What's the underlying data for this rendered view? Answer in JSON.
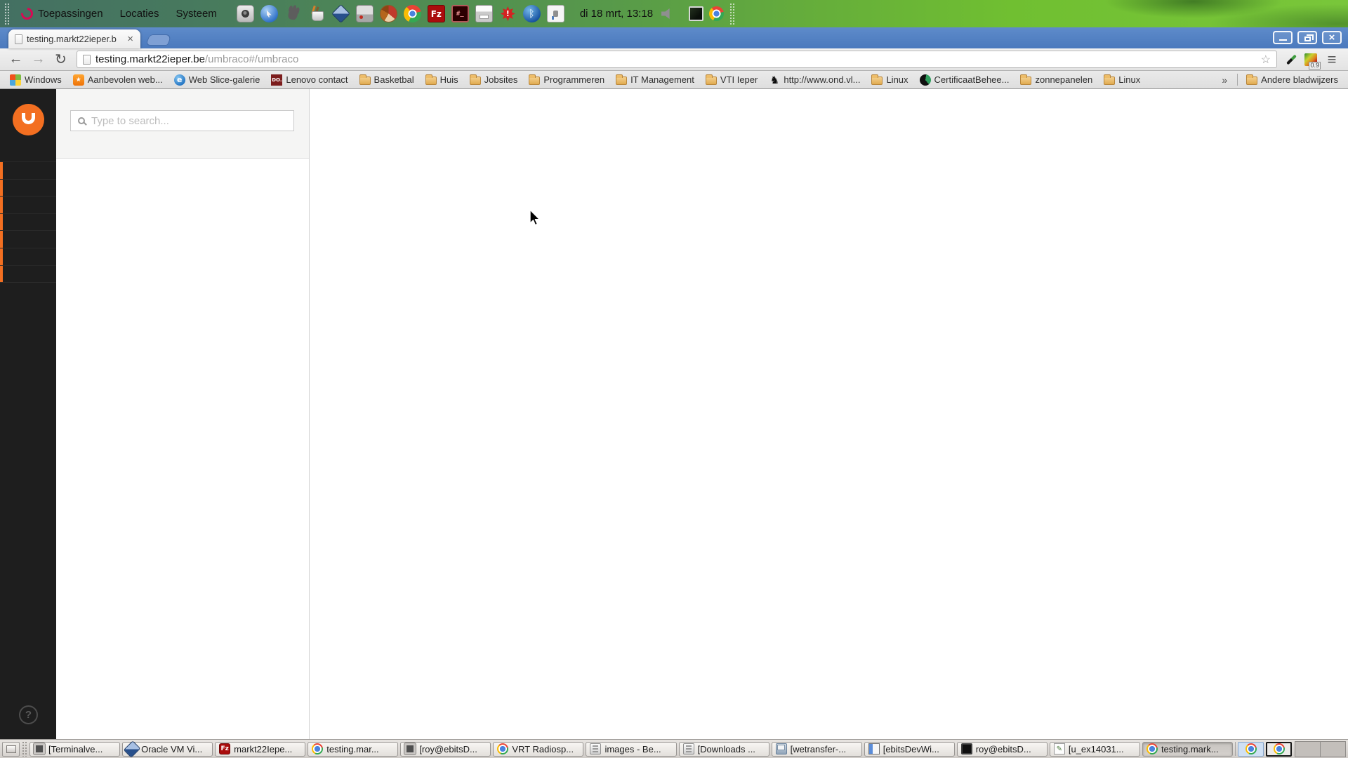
{
  "colors": {
    "umbraco_orange": "#f36f21",
    "chrome_frame_blue": "#4d7bbd",
    "panel_green": "#6ab92f",
    "sidebar_dark": "#1e1e1e"
  },
  "desktop": {
    "top_panel": {
      "menus": [
        {
          "label": "Toepassingen",
          "icon": "debian-swirl-icon"
        },
        {
          "label": "Locaties"
        },
        {
          "label": "Systeem"
        }
      ],
      "launchers": [
        {
          "icon": "speaker-icon"
        },
        {
          "icon": "web-browser-icon"
        },
        {
          "icon": "gnome-foot-icon"
        },
        {
          "icon": "graphics-tools-icon"
        },
        {
          "icon": "virtualbox-icon"
        },
        {
          "icon": "harddrive-icon"
        },
        {
          "icon": "disk-usage-icon"
        },
        {
          "icon": "chrome-icon"
        },
        {
          "icon": "filezilla-icon",
          "glyph": "Fz"
        },
        {
          "icon": "terminal-red-icon",
          "glyph": "#_"
        },
        {
          "icon": "printer-icon"
        },
        {
          "icon": "alert-icon"
        },
        {
          "icon": "bluetooth-icon"
        },
        {
          "icon": "network-icon"
        }
      ],
      "clock": "di 18 mrt, 13:18",
      "tray": [
        {
          "icon": "terminal-window-icon"
        },
        {
          "icon": "chrome-icon"
        }
      ]
    },
    "taskbar": {
      "items": [
        {
          "label": "[Terminalve...",
          "icon": "terminal-icon"
        },
        {
          "label": "Oracle VM Vi...",
          "icon": "virtualbox-icon"
        },
        {
          "label": "markt22Iepe...",
          "icon": "filezilla-icon",
          "glyph": "Fz"
        },
        {
          "label": "testing.mar...",
          "icon": "chrome-icon"
        },
        {
          "label": "[roy@ebitsD...",
          "icon": "terminal-icon"
        },
        {
          "label": "VRT Radiosp...",
          "icon": "chrome-icon"
        },
        {
          "label": "images - Be...",
          "icon": "file-manager-icon"
        },
        {
          "label": "[Downloads ...",
          "icon": "file-manager-icon"
        },
        {
          "label": "[wetransfer-...",
          "icon": "archive-icon"
        },
        {
          "label": "[ebitsDevWi...",
          "icon": "spreadsheet-icon"
        },
        {
          "label": "roy@ebitsD...",
          "icon": "terminal-dark-icon"
        },
        {
          "label": "[u_ex14031...",
          "icon": "text-editor-icon"
        },
        {
          "label": "testing.mark...",
          "icon": "chrome-icon",
          "cls": "active"
        }
      ],
      "tray": [
        {
          "icon": "chrome-icon",
          "cls": "selected"
        },
        {
          "icon": "chrome-icon",
          "cls": "outlined"
        }
      ],
      "workspace_count": 2
    }
  },
  "browser": {
    "tab": {
      "title": "testing.markt22ieper.b",
      "close_glyph": "×"
    },
    "toolbar": {
      "back_glyph": "←",
      "forward_glyph": "→",
      "reload_glyph": "↻",
      "url_host": "testing.markt22ieper.be",
      "url_path": "/umbraco#/umbraco",
      "star_glyph": "☆",
      "extensions": [
        {
          "icon": "eyedropper-icon"
        },
        {
          "icon": "color-picker-icon",
          "badge": "0.9"
        }
      ],
      "menu_glyph": "≡"
    },
    "bookmarks": [
      {
        "label": "Windows",
        "icon": "windows-icon"
      },
      {
        "label": "Aanbevolen web...",
        "icon": "ie-favorites-icon"
      },
      {
        "label": "Web Slice-galerie",
        "icon": "ie-slice-icon",
        "glyph": "e"
      },
      {
        "label": "Lenovo contact",
        "icon": "lenovo-contact-icon",
        "glyph": "DO."
      },
      {
        "label": "Basketbal",
        "icon": "folder-icon"
      },
      {
        "label": "Huis",
        "icon": "folder-icon"
      },
      {
        "label": "Jobsites",
        "icon": "folder-icon"
      },
      {
        "label": "Programmeren",
        "icon": "folder-icon"
      },
      {
        "label": "IT Management",
        "icon": "folder-icon"
      },
      {
        "label": "VTI Ieper",
        "icon": "folder-icon"
      },
      {
        "label": "http://www.ond.vl...",
        "icon": "flemish-lion-icon"
      },
      {
        "label": "Linux",
        "icon": "folder-icon"
      },
      {
        "label": "CertificaatBehee...",
        "icon": "certificate-site-icon"
      },
      {
        "label": "zonnepanelen",
        "icon": "folder-icon"
      },
      {
        "label": "Linux",
        "icon": "folder-icon"
      }
    ],
    "bookmarks_overflow_glyph": "»",
    "other_bookmarks_label": "Andere bladwijzers"
  },
  "umbraco": {
    "search_placeholder": "Type to search...",
    "sidebar_placeholder_rows": [
      {},
      {},
      {},
      {},
      {},
      {},
      {}
    ],
    "help_glyph": "?"
  }
}
